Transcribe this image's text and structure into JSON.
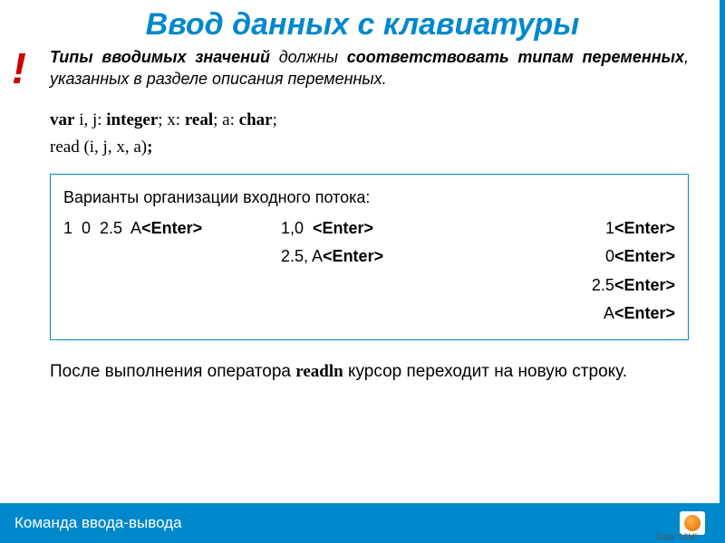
{
  "title": "Ввод данных с клавиатуры",
  "note_mark": "!",
  "note": {
    "p1a": "Типы вводимых значений",
    "p1b": " должны ",
    "p1c": "соответствовать типам переменных",
    "p1d": ", указанных в разделе описания переменных."
  },
  "code": {
    "line1_a": "var",
    "line1_b": " i, j: ",
    "line1_c": "integer",
    "line1_d": "; x: ",
    "line1_e": "real",
    "line1_f": "; a: ",
    "line1_g": "char",
    "line1_h": ";",
    "line2_a": "read ",
    "line2_b": "(i, j, x, a)",
    "line2_c": ";"
  },
  "box": {
    "title": "Варианты организации входного потока:",
    "r1c1": "1  0  2.5  A",
    "r1c2": "1,0  ",
    "r1c3": "1",
    "r2c1": "",
    "r2c2": "2.5, A",
    "r2c3": "0",
    "r3c3": "2.5",
    "r4c3": "A",
    "enter": "<Enter>"
  },
  "after": {
    "t1": "После выполнения оператора  ",
    "kw": "readln",
    "t2": "   курсор переходит на новую строку."
  },
  "footer": {
    "title": "Команда ввода-вывода",
    "caption": "База \"12М\""
  }
}
